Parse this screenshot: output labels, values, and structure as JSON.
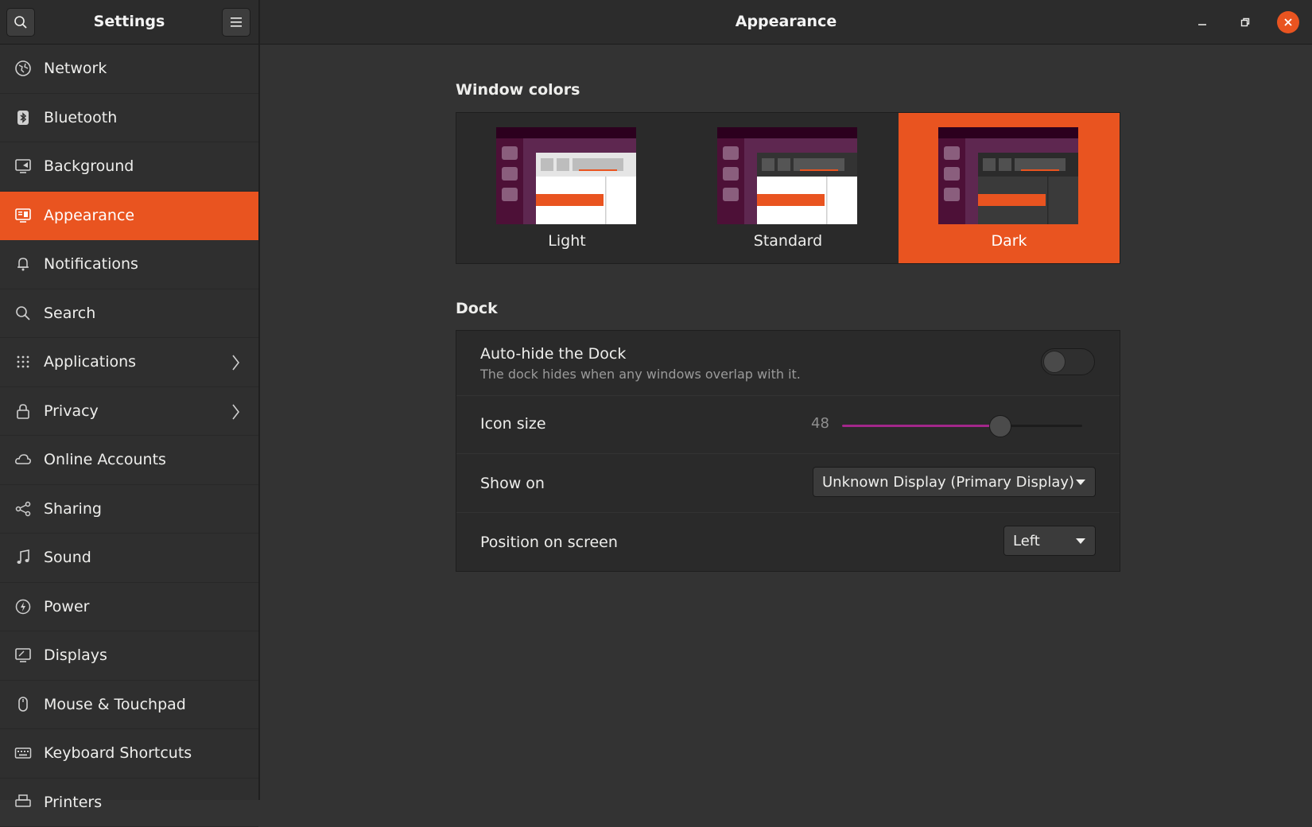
{
  "sidebar": {
    "title": "Settings",
    "items": [
      {
        "label": "Network",
        "icon": "network-icon"
      },
      {
        "label": "Bluetooth",
        "icon": "bluetooth-icon"
      },
      {
        "label": "Background",
        "icon": "background-icon"
      },
      {
        "label": "Appearance",
        "icon": "appearance-icon",
        "active": true
      },
      {
        "label": "Notifications",
        "icon": "bell-icon"
      },
      {
        "label": "Search",
        "icon": "search-icon"
      },
      {
        "label": "Applications",
        "icon": "grid-icon",
        "has_submenu": true
      },
      {
        "label": "Privacy",
        "icon": "lock-icon",
        "has_submenu": true
      },
      {
        "label": "Online Accounts",
        "icon": "cloud-icon"
      },
      {
        "label": "Sharing",
        "icon": "share-icon"
      },
      {
        "label": "Sound",
        "icon": "music-note-icon"
      },
      {
        "label": "Power",
        "icon": "power-icon"
      },
      {
        "label": "Displays",
        "icon": "display-icon"
      },
      {
        "label": "Mouse & Touchpad",
        "icon": "mouse-icon"
      },
      {
        "label": "Keyboard Shortcuts",
        "icon": "keyboard-icon"
      },
      {
        "label": "Printers",
        "icon": "printer-icon"
      }
    ]
  },
  "header": {
    "title": "Appearance"
  },
  "window_colors": {
    "title": "Window colors",
    "options": [
      {
        "label": "Light"
      },
      {
        "label": "Standard"
      },
      {
        "label": "Dark",
        "selected": true
      }
    ]
  },
  "dock": {
    "title": "Dock",
    "auto_hide": {
      "label": "Auto-hide the Dock",
      "description": "The dock hides when any windows overlap with it.",
      "enabled": false
    },
    "icon_size": {
      "label": "Icon size",
      "value": "48",
      "fraction": 0.66
    },
    "show_on": {
      "label": "Show on",
      "value": "Unknown Display (Primary Display)"
    },
    "position": {
      "label": "Position on screen",
      "value": "Left"
    }
  },
  "colors": {
    "accent": "#e95420",
    "slider_fill": "#a2278a",
    "thumb_dark_purple": "#2c001e",
    "thumb_purple": "#5e2750"
  }
}
